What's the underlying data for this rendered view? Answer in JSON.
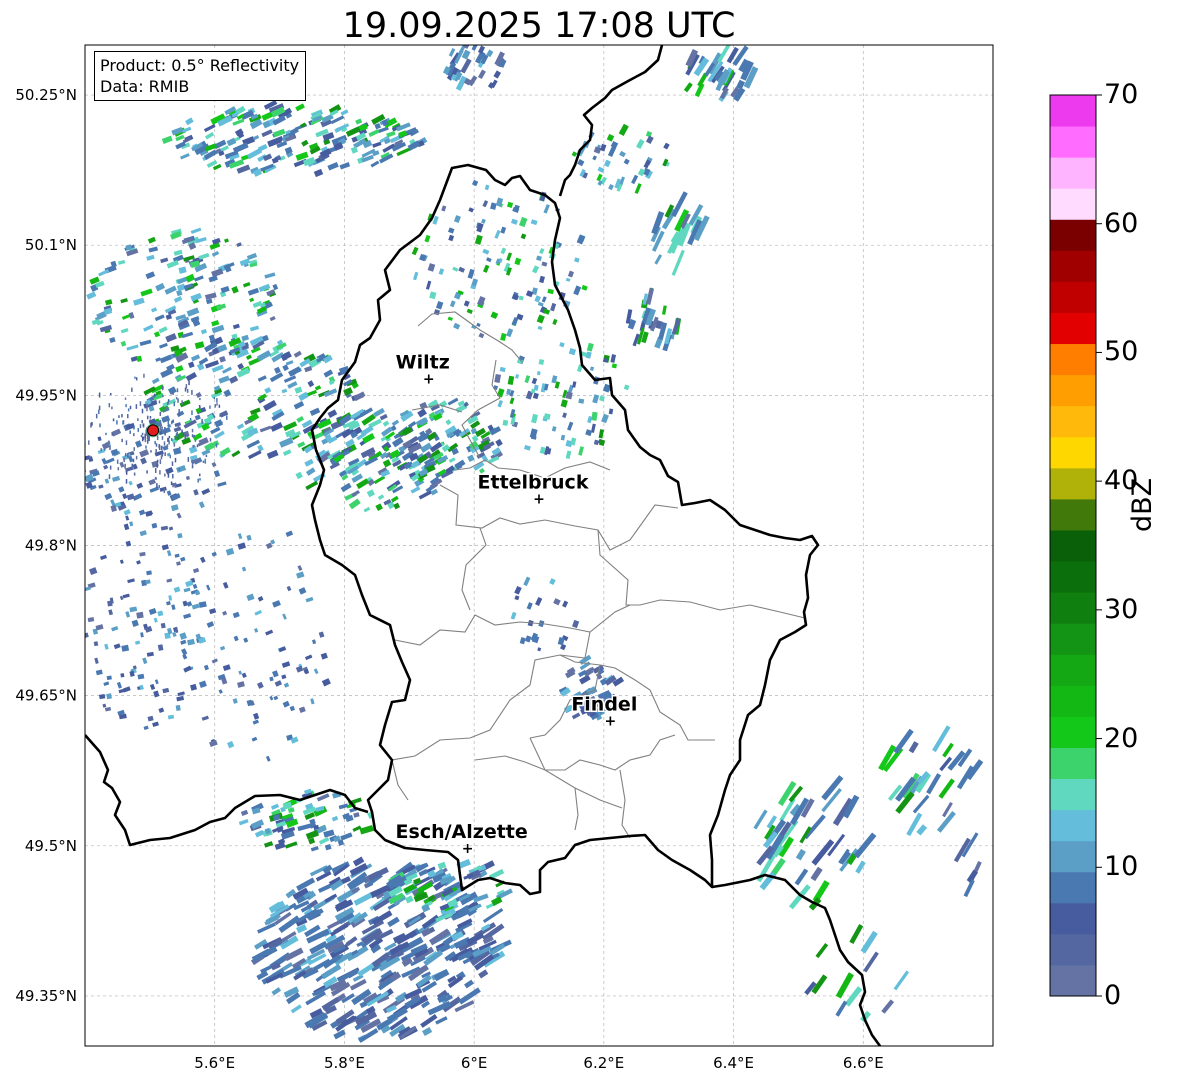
{
  "title": "19.09.2025 17:08 UTC",
  "info": {
    "product": "Product: 0.5° Reflectivity",
    "data_source": "Data: RMIB"
  },
  "map": {
    "lon_range": [
      5.4,
      6.8
    ],
    "lat_range": [
      49.3,
      50.3
    ],
    "lat_ticks": [
      {
        "value": 50.25,
        "label": "50.25°N"
      },
      {
        "value": 50.1,
        "label": "50.1°N"
      },
      {
        "value": 49.95,
        "label": "49.95°N"
      },
      {
        "value": 49.8,
        "label": "49.8°N"
      },
      {
        "value": 49.65,
        "label": "49.65°N"
      },
      {
        "value": 49.5,
        "label": "49.5°N"
      },
      {
        "value": 49.35,
        "label": "49.35°N"
      }
    ],
    "lon_ticks": [
      {
        "value": 5.6,
        "label": "5.6°E"
      },
      {
        "value": 5.8,
        "label": "5.8°E"
      },
      {
        "value": 6.0,
        "label": "6°E"
      },
      {
        "value": 6.2,
        "label": "6.2°E"
      },
      {
        "value": 6.4,
        "label": "6.4°E"
      },
      {
        "value": 6.6,
        "label": "6.6°E"
      }
    ],
    "radar_site": {
      "lon": 5.505,
      "lat": 49.915
    },
    "cities": [
      {
        "name": "Wiltz",
        "lon": 5.93,
        "lat": 49.967
      },
      {
        "name": "Ettelbruck",
        "lon": 6.1,
        "lat": 49.847
      },
      {
        "name": "Findel",
        "lon": 6.21,
        "lat": 49.625
      },
      {
        "name": "Esch/Alzette",
        "lon": 5.99,
        "lat": 49.498
      }
    ],
    "border_color": "#000000",
    "district_color": "#808080"
  },
  "colorbar": {
    "label": "dBZ",
    "min": 0,
    "max": 70,
    "step": 2.5,
    "tick_labels": [
      "0",
      "10",
      "20",
      "30",
      "40",
      "50",
      "60",
      "70"
    ],
    "colors": [
      "#6473a4",
      "#5567a0",
      "#475c9e",
      "#4a78b1",
      "#5b9fc7",
      "#64bedb",
      "#60d8c0",
      "#3dd36c",
      "#14c819",
      "#14b814",
      "#14a814",
      "#149414",
      "#0f800f",
      "#0b700b",
      "#096009",
      "#417a0a",
      "#b0b209",
      "#ffd700",
      "#ffb90b",
      "#ff9e00",
      "#ff7e00",
      "#e30000",
      "#c00000",
      "#a00000",
      "#7a0000",
      "#ffdcff",
      "#ffb4ff",
      "#ff6cff",
      "#ee3aee"
    ]
  }
}
